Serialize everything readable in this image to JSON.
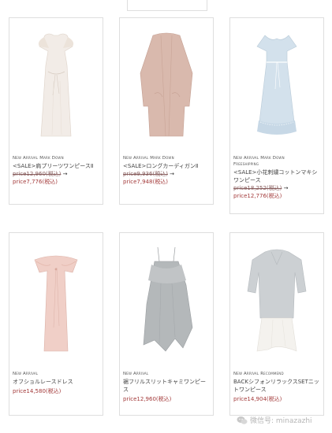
{
  "cards": [
    {
      "tags": [
        "New Arrival Mark Down"
      ],
      "name": "<SALE>肩プリーツワンピースⅡ",
      "old_price": "price12,960(税込)",
      "arrow": "→",
      "new_price": "price7,776(税込)"
    },
    {
      "tags": [
        "New Arrival Mark Down"
      ],
      "name": "<SALE>ロングカーディガンⅡ",
      "old_price": "price9,936(税込)",
      "arrow": "→",
      "new_price": "price7,948(税込)"
    },
    {
      "tags": [
        "New Arrival Mark Down",
        "Freeshipping"
      ],
      "name": "<SALE>小花刺繍コットンマキシワンピース",
      "old_price": "price18,252(税込)",
      "arrow": "→",
      "new_price": "price12,776(税込)"
    },
    {
      "tags": [
        "New Arrival"
      ],
      "name": "オフショルレースドレス",
      "price": "price14,580(税込)"
    },
    {
      "tags": [
        "New Arrival"
      ],
      "name": "裾フリルスリットキャミワンピース",
      "price": "price12,960(税込)"
    },
    {
      "tags": [
        "New Arrival Recommend"
      ],
      "name": "BACKシフォンリラックスSETニットワンピース",
      "price": "price14,904(税込)"
    }
  ],
  "watermark": {
    "text": "微信号: minazazhi",
    "icon": "wechat-icon"
  }
}
